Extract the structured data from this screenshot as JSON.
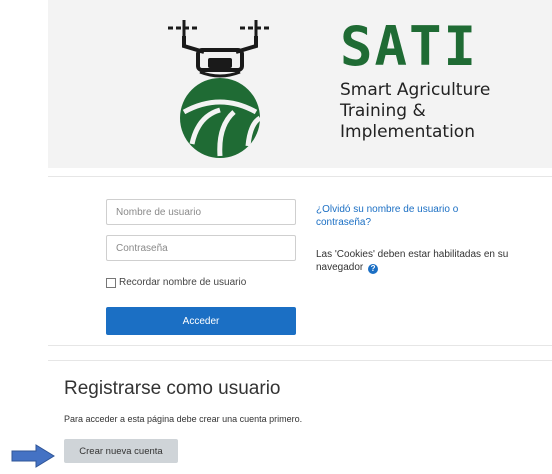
{
  "logo": {
    "word": "SATI",
    "tagline_line1": "Smart Agriculture",
    "tagline_line2": "Training &",
    "tagline_line3": "Implementation",
    "icon": "drone-field-icon",
    "brand_color": "#1f6b34"
  },
  "login": {
    "username_placeholder": "Nombre de usuario",
    "password_placeholder": "Contraseña",
    "remember_label": "Recordar nombre de usuario",
    "submit_label": "Acceder",
    "forgot_link": "¿Olvidó su nombre de usuario o contraseña?",
    "cookies_note": "Las 'Cookies' deben estar habilitadas en su navegador",
    "help_icon": "question-circle-icon",
    "accent_color": "#1b6fc4"
  },
  "register": {
    "title": "Registrarse como usuario",
    "text": "Para acceder a esta página debe crear una cuenta primero.",
    "create_label": "Crear nueva cuenta",
    "pointer_icon": "arrow-right-icon",
    "pointer_color": "#4472c4"
  }
}
